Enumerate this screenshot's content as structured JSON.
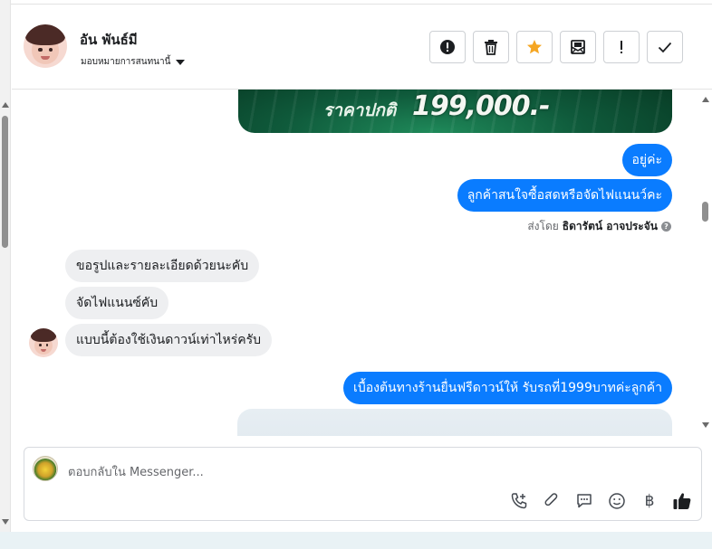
{
  "header": {
    "name": "อัน พันธ์มี",
    "assign_label": "มอบหมายการสนทนานี้",
    "actions": [
      {
        "name": "report-button",
        "icon": "exclamation-circle-icon"
      },
      {
        "name": "delete-button",
        "icon": "trash-icon"
      },
      {
        "name": "star-button",
        "icon": "star-icon"
      },
      {
        "name": "mark-unread-button",
        "icon": "envelope-icon"
      },
      {
        "name": "follow-up-button",
        "icon": "exclamation-icon"
      },
      {
        "name": "mark-done-button",
        "icon": "check-icon"
      }
    ]
  },
  "banner": {
    "label": "ราคาปกติ",
    "price": "199,000.-"
  },
  "messages": {
    "out_1": "อยู่ค่ะ",
    "out_2": "ลูกค้าสนใจซื้อสดหรือจัดไฟแนนว์คะ",
    "sent_by_prefix": "ส่งโดย",
    "sent_by_name": "ธิดารัตน์ อาจประจัน",
    "in_1": "ขอรูปและรายละเอียดด้วยนะคับ",
    "in_2": "จัดไฟแนนซ์คับ",
    "in_3": "แบบนี้ต้องใช้เงินดาวน์เท่าไหร่ครับ",
    "out_3": "เบื้องต้นทางร้านยื่นฟรีดาวน์ให้ รับรถที่1999บาทค่ะลูกค้า"
  },
  "composer": {
    "placeholder": "ตอบกลับใน Messenger...",
    "tools": [
      "call-add-icon",
      "paperclip-icon",
      "chat-bubble-icon",
      "emoji-icon",
      "baht-icon",
      "thumbs-up-icon"
    ],
    "baht_symbol": "฿"
  },
  "colors": {
    "outgoing_bubble": "#0a7cff",
    "incoming_bubble": "#eeeff1",
    "star": "#f5a623"
  }
}
